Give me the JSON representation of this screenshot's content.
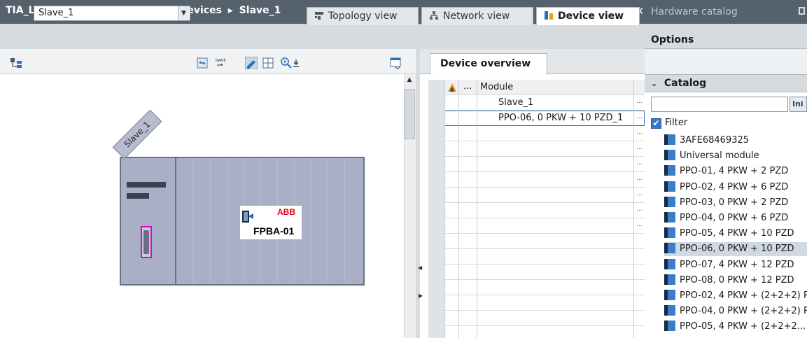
{
  "title_bar": {
    "crumbs": [
      "TIA_Lib_S7-1200",
      "Unassigned devices",
      "Slave_1"
    ],
    "separator": "▸",
    "controls": [
      "_",
      "▣",
      "▬",
      "✕"
    ]
  },
  "view_tabs": {
    "topology": "Topology view",
    "network": "Network view",
    "device": "Device view"
  },
  "toolbar": {
    "device_select_value": "Slave_1"
  },
  "canvas": {
    "device_label": "Slave_1",
    "logo_brand": "ABB",
    "logo_model": "FPBA-01"
  },
  "device_overview": {
    "tab_label": "Device overview",
    "header": {
      "col_dots": "...",
      "col_module": "Module"
    },
    "rows": [
      {
        "module": "Slave_1"
      },
      {
        "module": "PPO-06, 0 PKW + 10 PZD_1"
      },
      {
        "module": ""
      },
      {
        "module": ""
      },
      {
        "module": ""
      },
      {
        "module": ""
      },
      {
        "module": ""
      },
      {
        "module": ""
      },
      {
        "module": ""
      },
      {
        "module": ""
      },
      {
        "module": ""
      },
      {
        "module": ""
      },
      {
        "module": ""
      },
      {
        "module": ""
      },
      {
        "module": ""
      },
      {
        "module": ""
      }
    ],
    "row_ellipsis": "..."
  },
  "catalog": {
    "title": "Hardware catalog",
    "options_label": "Options",
    "section_label": "Catalog",
    "search_placeholder": "",
    "search_button": "Ini",
    "filter_label": "Filter",
    "filter_checked": true,
    "items": [
      "3AFE68469325",
      "Universal module",
      "PPO-01, 4 PKW + 2 PZD",
      "PPO-02, 4 PKW + 6 PZD",
      "PPO-03, 0 PKW + 2 PZD",
      "PPO-04, 0 PKW + 6 PZD",
      "PPO-05, 4 PKW + 10 PZD",
      "PPO-06, 0 PKW + 10 PZD",
      "PPO-07, 4 PKW + 12 PZD",
      "PPO-08, 0 PKW + 12 PZD",
      "PPO-02, 4 PKW + (2+2+2) PZD",
      "PPO-04, 0 PKW + (2+2+2) PZD",
      "PPO-05, 4 PKW + (2+2+2..."
    ],
    "selected_index": 7
  },
  "colors": {
    "title_bar": "#55626e",
    "tab_strip": "#d6dbe0",
    "rack": "#a9afc4",
    "port_highlight": "#e000e0",
    "selection": "#cfd8e3"
  }
}
